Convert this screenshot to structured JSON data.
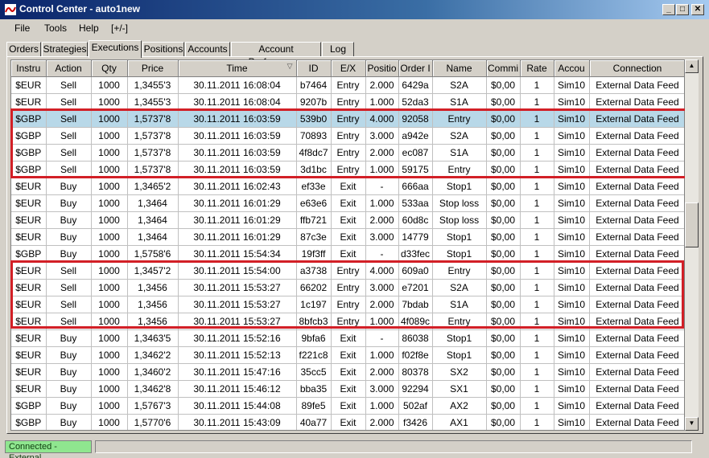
{
  "window": {
    "title": "Control Center - auto1new",
    "minimize": "_",
    "maximize": "□",
    "close": "✕"
  },
  "menu": [
    "File",
    "Tools",
    "Help",
    "[+/-]"
  ],
  "tabs": [
    "Orders",
    "Strategies",
    "Executions",
    "Positions",
    "Accounts",
    "Account Performance",
    "Log"
  ],
  "active_tab": "Executions",
  "columns": [
    "Instru",
    "Action",
    "Qty",
    "Price",
    "Time",
    "ID",
    "E/X",
    "Positio",
    "Order I",
    "Name",
    "Commi",
    "Rate",
    "Accou",
    "Connection"
  ],
  "sort_indicator": "▽",
  "rows": [
    [
      "$EUR",
      "Sell",
      "1000",
      "1,3455'3",
      "30.11.2011 16:08:04",
      "b7464",
      "Entry",
      "2.000",
      "6429a",
      "S2A",
      "$0,00",
      "1",
      "Sim10",
      "External Data Feed"
    ],
    [
      "$EUR",
      "Sell",
      "1000",
      "1,3455'3",
      "30.11.2011 16:08:04",
      "9207b",
      "Entry",
      "1.000",
      "52da3",
      "S1A",
      "$0,00",
      "1",
      "Sim10",
      "External Data Feed"
    ],
    [
      "$GBP",
      "Sell",
      "1000",
      "1,5737'8",
      "30.11.2011 16:03:59",
      "539b0",
      "Entry",
      "4.000",
      "92058",
      "Entry",
      "$0,00",
      "1",
      "Sim10",
      "External Data Feed"
    ],
    [
      "$GBP",
      "Sell",
      "1000",
      "1,5737'8",
      "30.11.2011 16:03:59",
      "70893",
      "Entry",
      "3.000",
      "a942e",
      "S2A",
      "$0,00",
      "1",
      "Sim10",
      "External Data Feed"
    ],
    [
      "$GBP",
      "Sell",
      "1000",
      "1,5737'8",
      "30.11.2011 16:03:59",
      "4f8dc7",
      "Entry",
      "2.000",
      "ec087",
      "S1A",
      "$0,00",
      "1",
      "Sim10",
      "External Data Feed"
    ],
    [
      "$GBP",
      "Sell",
      "1000",
      "1,5737'8",
      "30.11.2011 16:03:59",
      "3d1bc",
      "Entry",
      "1.000",
      "59175",
      "Entry",
      "$0,00",
      "1",
      "Sim10",
      "External Data Feed"
    ],
    [
      "$EUR",
      "Buy",
      "1000",
      "1,3465'2",
      "30.11.2011 16:02:43",
      "ef33e",
      "Exit",
      "-",
      "666aa",
      "Stop1",
      "$0,00",
      "1",
      "Sim10",
      "External Data Feed"
    ],
    [
      "$EUR",
      "Buy",
      "1000",
      "1,3464",
      "30.11.2011 16:01:29",
      "e63e6",
      "Exit",
      "1.000",
      "533aa",
      "Stop loss",
      "$0,00",
      "1",
      "Sim10",
      "External Data Feed"
    ],
    [
      "$EUR",
      "Buy",
      "1000",
      "1,3464",
      "30.11.2011 16:01:29",
      "ffb721",
      "Exit",
      "2.000",
      "60d8c",
      "Stop loss",
      "$0,00",
      "1",
      "Sim10",
      "External Data Feed"
    ],
    [
      "$EUR",
      "Buy",
      "1000",
      "1,3464",
      "30.11.2011 16:01:29",
      "87c3e",
      "Exit",
      "3.000",
      "14779",
      "Stop1",
      "$0,00",
      "1",
      "Sim10",
      "External Data Feed"
    ],
    [
      "$GBP",
      "Buy",
      "1000",
      "1,5758'6",
      "30.11.2011 15:54:34",
      "19f3ff",
      "Exit",
      "-",
      "d33fec",
      "Stop1",
      "$0,00",
      "1",
      "Sim10",
      "External Data Feed"
    ],
    [
      "$EUR",
      "Sell",
      "1000",
      "1,3457'2",
      "30.11.2011 15:54:00",
      "a3738",
      "Entry",
      "4.000",
      "609a0",
      "Entry",
      "$0,00",
      "1",
      "Sim10",
      "External Data Feed"
    ],
    [
      "$EUR",
      "Sell",
      "1000",
      "1,3456",
      "30.11.2011 15:53:27",
      "66202",
      "Entry",
      "3.000",
      "e7201",
      "S2A",
      "$0,00",
      "1",
      "Sim10",
      "External Data Feed"
    ],
    [
      "$EUR",
      "Sell",
      "1000",
      "1,3456",
      "30.11.2011 15:53:27",
      "1c197",
      "Entry",
      "2.000",
      "7bdab",
      "S1A",
      "$0,00",
      "1",
      "Sim10",
      "External Data Feed"
    ],
    [
      "$EUR",
      "Sell",
      "1000",
      "1,3456",
      "30.11.2011 15:53:27",
      "8bfcb3",
      "Entry",
      "1.000",
      "4f089c",
      "Entry",
      "$0,00",
      "1",
      "Sim10",
      "External Data Feed"
    ],
    [
      "$EUR",
      "Buy",
      "1000",
      "1,3463'5",
      "30.11.2011 15:52:16",
      "9bfa6",
      "Exit",
      "-",
      "86038",
      "Stop1",
      "$0,00",
      "1",
      "Sim10",
      "External Data Feed"
    ],
    [
      "$EUR",
      "Buy",
      "1000",
      "1,3462'2",
      "30.11.2011 15:52:13",
      "f221c8",
      "Exit",
      "1.000",
      "f02f8e",
      "Stop1",
      "$0,00",
      "1",
      "Sim10",
      "External Data Feed"
    ],
    [
      "$EUR",
      "Buy",
      "1000",
      "1,3460'2",
      "30.11.2011 15:47:16",
      "35cc5",
      "Exit",
      "2.000",
      "80378",
      "SX2",
      "$0,00",
      "1",
      "Sim10",
      "External Data Feed"
    ],
    [
      "$EUR",
      "Buy",
      "1000",
      "1,3462'8",
      "30.11.2011 15:46:12",
      "bba35",
      "Exit",
      "3.000",
      "92294",
      "SX1",
      "$0,00",
      "1",
      "Sim10",
      "External Data Feed"
    ],
    [
      "$GBP",
      "Buy",
      "1000",
      "1,5767'3",
      "30.11.2011 15:44:08",
      "89fe5",
      "Exit",
      "1.000",
      "502af",
      "AX2",
      "$0,00",
      "1",
      "Sim10",
      "External Data Feed"
    ],
    [
      "$GBP",
      "Buy",
      "1000",
      "1,5770'6",
      "30.11.2011 15:43:09",
      "40a77",
      "Exit",
      "2.000",
      "f3426",
      "AX1",
      "$0,00",
      "1",
      "Sim10",
      "External Data Feed"
    ]
  ],
  "selected_row": 2,
  "highlight_groups": [
    [
      2,
      5
    ],
    [
      11,
      14
    ]
  ],
  "status": {
    "connection": "Connected - External"
  },
  "colors": {
    "highlight_border": "#d21f26",
    "selected_row": "#b8d8e8",
    "status_ok": "#8fe68f"
  }
}
